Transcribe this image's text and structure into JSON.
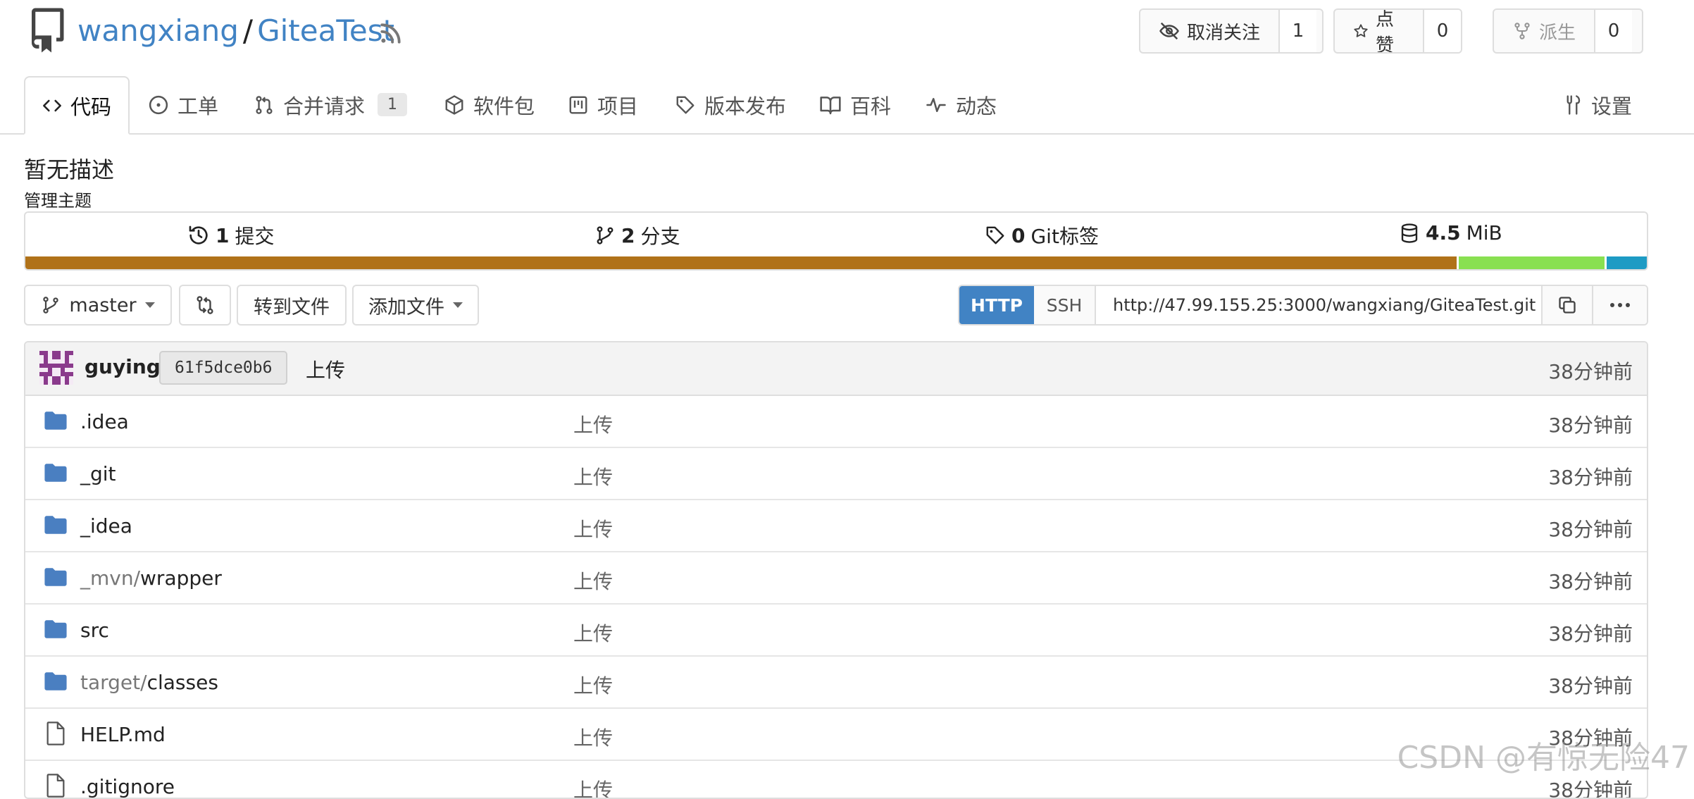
{
  "header": {
    "owner": "wangxiang",
    "separator": "/",
    "repo": "GiteaTest",
    "unwatch_label": "取消关注",
    "watch_count": "1",
    "star_label": "点赞",
    "star_count": "0",
    "fork_label": "派生",
    "fork_count": "0"
  },
  "tabs": {
    "code": "代码",
    "issues": "工单",
    "pulls": "合并请求",
    "pulls_count": "1",
    "packages": "软件包",
    "projects": "项目",
    "releases": "版本发布",
    "wiki": "百科",
    "activity": "动态",
    "settings": "设置"
  },
  "repo": {
    "description": "暂无描述",
    "manage_topics": "管理主题"
  },
  "stats": {
    "commits_num": "1",
    "commits_label": "提交",
    "branches_num": "2",
    "branches_label": "分支",
    "tags_num": "0",
    "tags_label": "Git标签",
    "size_num": "4.5",
    "size_unit": "MiB"
  },
  "languages": [
    {
      "color": "#b07219",
      "fraction": 0.885
    },
    {
      "color": "#89e051",
      "fraction": 0.09
    },
    {
      "color": "#1e9bc4",
      "fraction": 0.025
    }
  ],
  "toolbar": {
    "branch": "master",
    "goto_file": "转到文件",
    "add_file": "添加文件"
  },
  "clone": {
    "http": "HTTP",
    "ssh": "SSH",
    "url": "http://47.99.155.25:3000/wangxiang/GiteaTest.git"
  },
  "latest_commit": {
    "author": "guying",
    "sha": "61f5dce0b6",
    "message": "上传",
    "time": "38分钟前"
  },
  "files": [
    {
      "type": "folder",
      "dim": "",
      "name": ".idea",
      "message": "上传",
      "time": "38分钟前"
    },
    {
      "type": "folder",
      "dim": "",
      "name": "_git",
      "message": "上传",
      "time": "38分钟前"
    },
    {
      "type": "folder",
      "dim": "",
      "name": "_idea",
      "message": "上传",
      "time": "38分钟前"
    },
    {
      "type": "folder",
      "dim": "_mvn/",
      "name": "wrapper",
      "message": "上传",
      "time": "38分钟前"
    },
    {
      "type": "folder",
      "dim": "",
      "name": "src",
      "message": "上传",
      "time": "38分钟前"
    },
    {
      "type": "folder",
      "dim": "target/",
      "name": "classes",
      "message": "上传",
      "time": "38分钟前"
    },
    {
      "type": "file",
      "dim": "",
      "name": "HELP.md",
      "message": "上传",
      "time": "38分钟前"
    },
    {
      "type": "file",
      "dim": "",
      "name": ".gitignore",
      "message": "上传",
      "time": "38分钟前"
    }
  ],
  "watermark": "CSDN @有惊无险47"
}
